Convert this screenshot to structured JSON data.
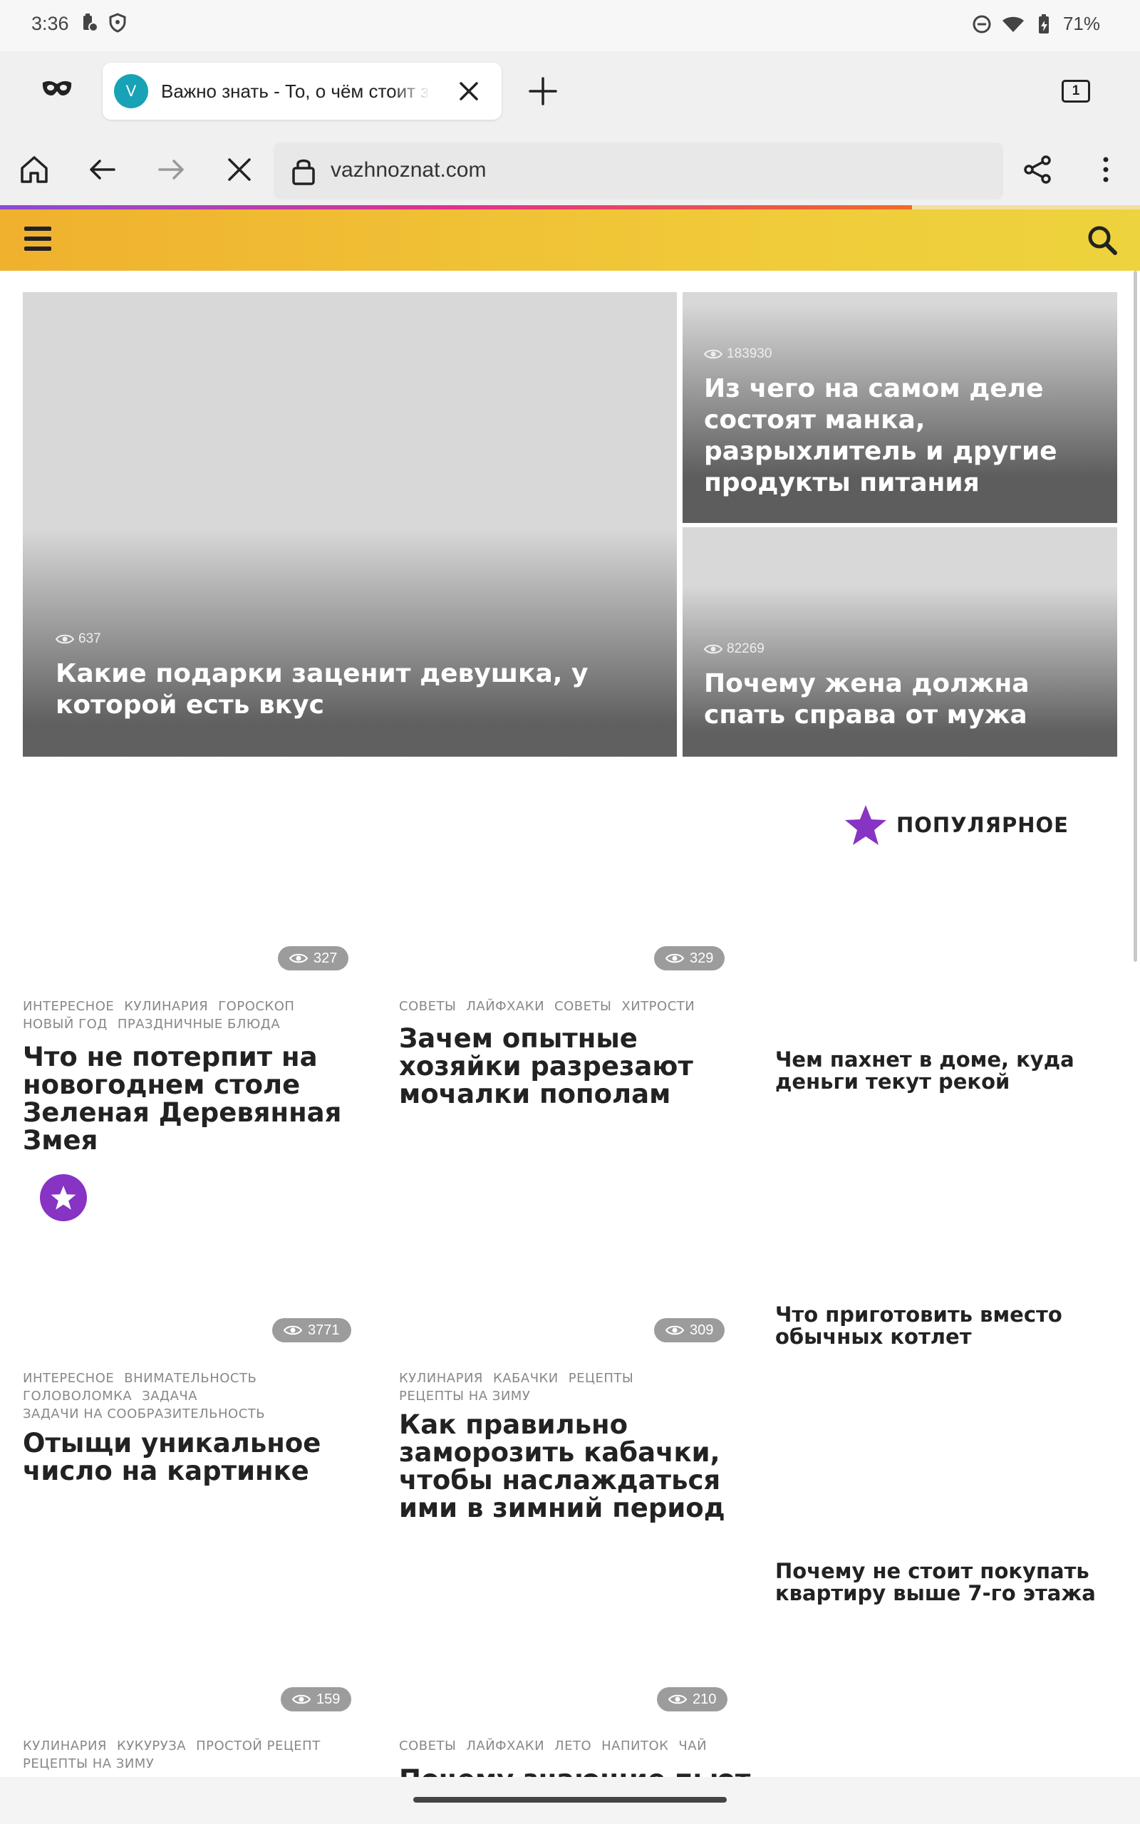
{
  "status": {
    "time": "3:36",
    "battery": "71%",
    "icons": [
      "battery-saver-icon",
      "shield-icon",
      "do-not-disturb-icon",
      "wifi-icon",
      "battery-icon"
    ]
  },
  "browser": {
    "tab_favicon_letter": "V",
    "tab_title": "Важно знать - То, о чём стоит знать",
    "tab_count": "1",
    "url": "vazhnoznat.com",
    "load_progress": 0.8
  },
  "hero": {
    "main": {
      "views": "637",
      "title": "Какие подарки заценит девушка, у которой есть вкус"
    },
    "top_right": {
      "views": "183930",
      "title": "Из чего на самом деле состоят манка, разрыхлитель и другие продукты питания"
    },
    "bottom_right": {
      "views": "82269",
      "title": "Почему жена должна спать справа от мужа"
    }
  },
  "popular": {
    "label": "ПОПУЛЯРНОЕ",
    "items": [
      "Чем пахнет в доме, куда деньги текут рекой",
      "Что приготовить вместо обычных котлет",
      "Почему не стоит покупать квартиру выше 7-го этажа"
    ]
  },
  "cards": [
    {
      "views": "327",
      "tags": [
        "Интересное",
        "Кулинария",
        "Гороскоп",
        "Новый год",
        "Праздничные блюда"
      ],
      "title": "Что не потерпит на новогоднем столе Зеленая Деревянная Змея"
    },
    {
      "views": "329",
      "tags": [
        "Советы",
        "Лайфхаки",
        "Советы",
        "Хитрости"
      ],
      "title": "Зачем опытные хозяйки разрезают мочалки пополам"
    },
    {
      "views": "3771",
      "tags": [
        "Интересное",
        "Внимательность",
        "Головоломка",
        "Задача",
        "Задачи на сообразительность"
      ],
      "title": "Отыщи уникальное число на картинке"
    },
    {
      "views": "309",
      "tags": [
        "Кулинария",
        "Кабачки",
        "Рецепты",
        "Рецепты на зиму"
      ],
      "title": "Как правильно заморозить кабачки, чтобы наслаждаться ими в зимний период"
    },
    {
      "views": "159",
      "tags": [
        "Кулинария",
        "Кукуруза",
        "Простой рецепт",
        "Рецепты на зиму"
      ],
      "title": ""
    },
    {
      "views": "210",
      "tags": [
        "Советы",
        "Лайфхаки",
        "Лето",
        "Напиток",
        "Чай"
      ],
      "title": "Почему знающие пьют в"
    }
  ],
  "colors": {
    "header_start": "#f0b12e",
    "header_end": "#edd33d",
    "accent_purple": "#8733c4",
    "badge_gray": "#9c9c9c",
    "favicon_teal": "#17a3b5"
  }
}
